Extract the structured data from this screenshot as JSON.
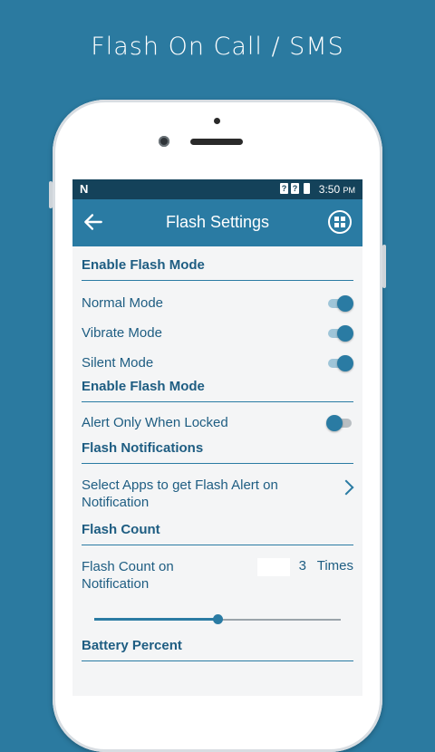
{
  "promo": {
    "title": "Flash On Call / SMS"
  },
  "status_bar": {
    "notification_letter": "N",
    "sim1": "?",
    "sim2": "?",
    "time": "3:50",
    "ampm": "PM"
  },
  "toolbar": {
    "title": "Flash Settings",
    "back_icon": "arrow-left-icon",
    "menu_icon": "grid-icon"
  },
  "sections": {
    "flash_mode": {
      "title": "Enable Flash Mode",
      "items": [
        {
          "label": "Normal Mode",
          "enabled": true
        },
        {
          "label": "Vibrate Mode",
          "enabled": true
        },
        {
          "label": "Silent Mode",
          "enabled": true
        }
      ]
    },
    "lock_mode": {
      "title": "Enable Flash Mode",
      "items": [
        {
          "label": "Alert Only When Locked",
          "enabled": false
        }
      ]
    },
    "notifications": {
      "title": "Flash Notifications",
      "select_apps_label": "Select Apps to get Flash Alert on Notification"
    },
    "flash_count": {
      "title": "Flash Count",
      "label": "Flash Count on Notification",
      "value": "3",
      "unit": "Times",
      "slider_fraction": 0.5
    },
    "battery": {
      "title": "Battery Percent"
    }
  },
  "colors": {
    "background": "#2b7aa0",
    "toolbar": "#2a7ba3",
    "status_bar": "#14425a",
    "accent": "#2a7ba3",
    "text": "#1e5d82"
  }
}
